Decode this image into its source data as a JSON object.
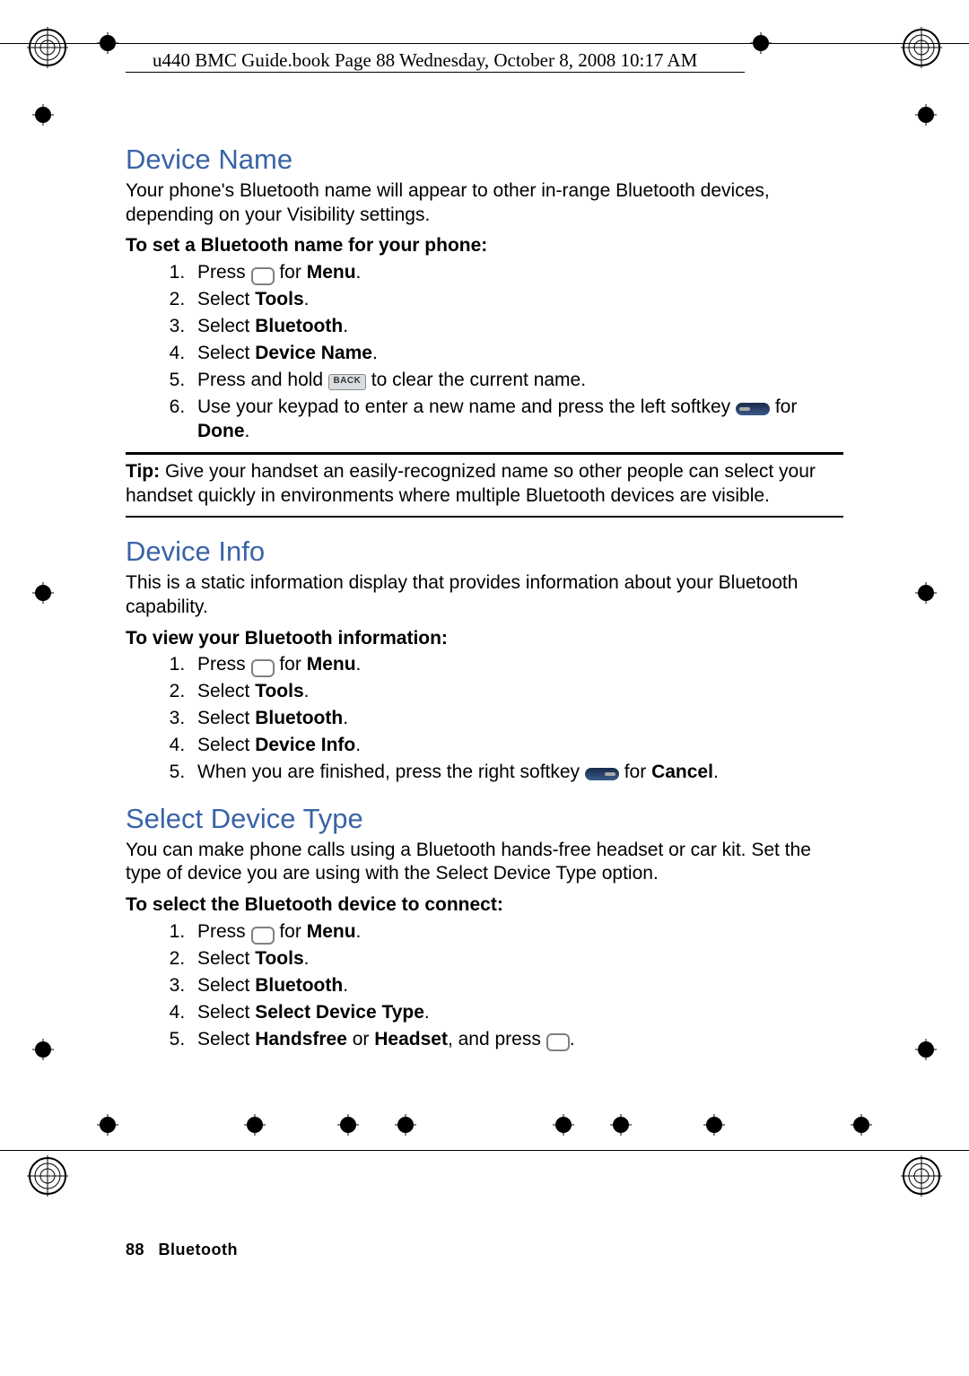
{
  "header": "u440 BMC Guide.book  Page 88  Wednesday, October 8, 2008  10:17 AM",
  "footer": {
    "page": "88",
    "section": "Bluetooth"
  },
  "sections": {
    "deviceName": {
      "title": "Device Name",
      "intro": "Your phone's Bluetooth name will appear to other in-range Bluetooth devices, depending on your Visibility settings.",
      "subhead": "To set a Bluetooth name for your phone:",
      "steps": {
        "s1a": "Press ",
        "s1b": " for ",
        "s1c": "Menu",
        "s1d": ".",
        "s2a": "Select ",
        "s2b": "Tools",
        "s2c": ".",
        "s3a": "Select ",
        "s3b": "Bluetooth",
        "s3c": ".",
        "s4a": "Select ",
        "s4b": "Device Name",
        "s4c": ".",
        "s5a": "Press and hold ",
        "s5b": " to clear the current name.",
        "s6a": "Use your keypad to enter a new name and press the left softkey ",
        "s6b": " for ",
        "s6c": "Done",
        "s6d": "."
      },
      "tipLabel": "Tip:",
      "tipText": " Give your handset an easily-recognized name so other people can select your handset quickly in environments where multiple Bluetooth devices are visible."
    },
    "deviceInfo": {
      "title": "Device Info",
      "intro": "This is a static information display that provides information about your Bluetooth capability.",
      "subhead": "To view your Bluetooth information:",
      "steps": {
        "s1a": "Press ",
        "s1b": " for ",
        "s1c": "Menu",
        "s1d": ".",
        "s2a": "Select ",
        "s2b": "Tools",
        "s2c": ".",
        "s3a": "Select ",
        "s3b": "Bluetooth",
        "s3c": ".",
        "s4a": "Select ",
        "s4b": "Device Info",
        "s4c": ".",
        "s5a": "When you are finished, press the right softkey ",
        "s5b": " for ",
        "s5c": "Cancel",
        "s5d": "."
      }
    },
    "selectDeviceType": {
      "title": "Select Device Type",
      "intro": "You can make phone calls using a Bluetooth hands-free headset or car kit. Set the type of device you are using with the Select Device Type option.",
      "subhead": "To select the Bluetooth device to connect:",
      "steps": {
        "s1a": "Press ",
        "s1b": " for ",
        "s1c": "Menu",
        "s1d": ".",
        "s2a": "Select ",
        "s2b": "Tools",
        "s2c": ".",
        "s3a": "Select ",
        "s3b": "Bluetooth",
        "s3c": ".",
        "s4a": "Select ",
        "s4b": "Select Device Type",
        "s4c": ".",
        "s5a": "Select ",
        "s5b": "Handsfree",
        "s5c": " or ",
        "s5d": "Headset",
        "s5e": ", and press ",
        "s5f": "."
      }
    }
  },
  "keys": {
    "back": "BACK",
    "ok": "MENU\nOK"
  }
}
